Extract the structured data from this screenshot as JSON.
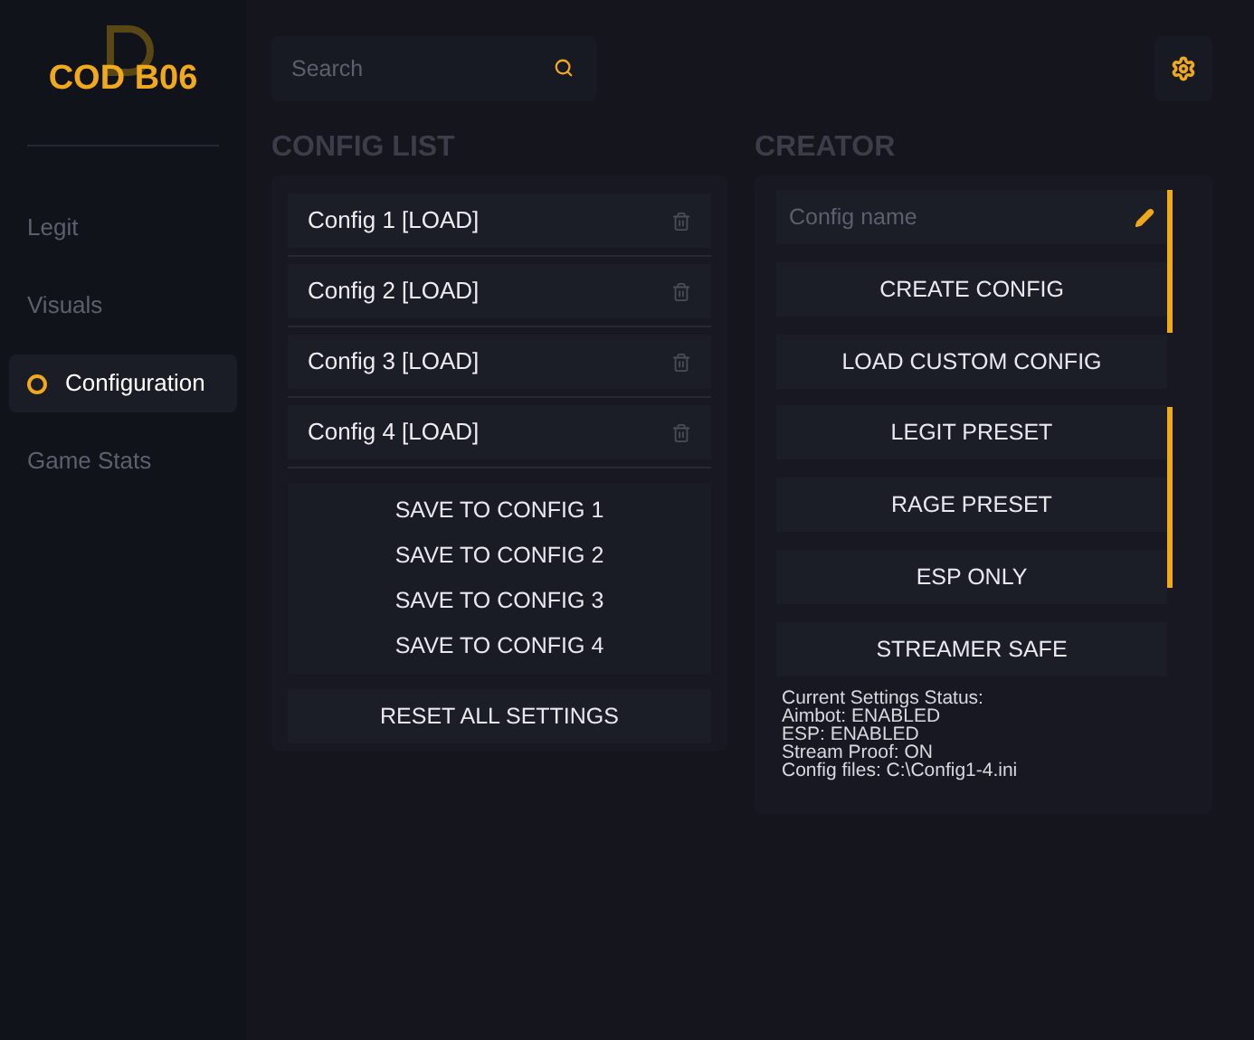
{
  "logo": {
    "text": "COD B06"
  },
  "sidebar": {
    "items": [
      {
        "label": "Legit",
        "selected": false
      },
      {
        "label": "Visuals",
        "selected": false
      },
      {
        "label": "Configuration",
        "selected": true
      },
      {
        "label": "Game Stats",
        "selected": false
      }
    ]
  },
  "search": {
    "placeholder": "Search"
  },
  "config_list": {
    "title": "CONFIG LIST",
    "configs": [
      "Config 1 [LOAD]",
      "Config 2 [LOAD]",
      "Config 3 [LOAD]",
      "Config 4 [LOAD]"
    ],
    "save_buttons": [
      "SAVE TO CONFIG 1",
      "SAVE TO CONFIG 2",
      "SAVE TO CONFIG 3",
      "SAVE TO CONFIG 4"
    ],
    "reset_button": "RESET ALL SETTINGS"
  },
  "creator": {
    "title": "CREATOR",
    "name_field": {
      "placeholder": "Config name"
    },
    "create_button": "CREATE CONFIG",
    "load_button": "LOAD CUSTOM CONFIG",
    "presets": [
      "LEGIT PRESET",
      "RAGE PRESET",
      "ESP ONLY",
      "STREAMER SAFE"
    ],
    "status_lines": [
      "Current Settings Status:",
      "Aimbot: ENABLED",
      "ESP: ENABLED",
      "Stream Proof: ON",
      "Config files: C:\\Config1-4.ini"
    ]
  }
}
